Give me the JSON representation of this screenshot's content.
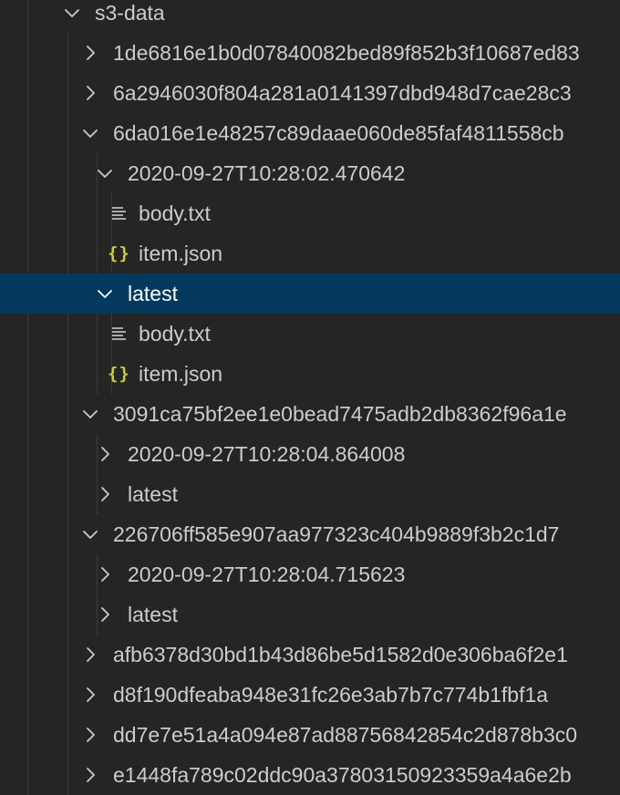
{
  "explorer": {
    "colors": {
      "background": "#252526",
      "selection": "#04395e",
      "text": "#cccccc",
      "selected_text": "#ffffff",
      "json_icon": "#cbcb41",
      "indent_guide": "#3b3b3b"
    },
    "tree": [
      {
        "label": "s3-data",
        "kind": "folder",
        "expanded": true,
        "depth": 0,
        "name": "folder-s3-data"
      },
      {
        "label": "1de6816e1b0d07840082bed89f852b3f10687ed83",
        "kind": "folder",
        "expanded": false,
        "depth": 1,
        "name": "folder-1de6816e"
      },
      {
        "label": "6a2946030f804a281a0141397dbd948d7cae28c3",
        "kind": "folder",
        "expanded": false,
        "depth": 1,
        "name": "folder-6a294603"
      },
      {
        "label": "6da016e1e48257c89daae060de85faf4811558cb",
        "kind": "folder",
        "expanded": true,
        "depth": 1,
        "name": "folder-6da016e1"
      },
      {
        "label": "2020-09-27T10:28:02.470642",
        "kind": "folder",
        "expanded": true,
        "depth": 2,
        "name": "folder-2020-09-27T10-28-02"
      },
      {
        "label": "body.txt",
        "kind": "txt",
        "depth": 3,
        "name": "file-body-txt"
      },
      {
        "label": "item.json",
        "kind": "json",
        "depth": 3,
        "name": "file-item-json"
      },
      {
        "label": "latest",
        "kind": "folder",
        "expanded": true,
        "depth": 2,
        "selected": true,
        "name": "folder-latest"
      },
      {
        "label": "body.txt",
        "kind": "txt",
        "depth": 3,
        "name": "file-body-txt"
      },
      {
        "label": "item.json",
        "kind": "json",
        "depth": 3,
        "name": "file-item-json"
      },
      {
        "label": "3091ca75bf2ee1e0bead7475adb2db8362f96a1e",
        "kind": "folder",
        "expanded": true,
        "depth": 1,
        "name": "folder-3091ca75"
      },
      {
        "label": "2020-09-27T10:28:04.864008",
        "kind": "folder",
        "expanded": false,
        "depth": 2,
        "name": "folder-2020-09-27T10-28-04-864008"
      },
      {
        "label": "latest",
        "kind": "folder",
        "expanded": false,
        "depth": 2,
        "name": "folder-latest"
      },
      {
        "label": "226706ff585e907aa977323c404b9889f3b2c1d7",
        "kind": "folder",
        "expanded": true,
        "depth": 1,
        "name": "folder-226706ff"
      },
      {
        "label": "2020-09-27T10:28:04.715623",
        "kind": "folder",
        "expanded": false,
        "depth": 2,
        "name": "folder-2020-09-27T10-28-04-715623"
      },
      {
        "label": "latest",
        "kind": "folder",
        "expanded": false,
        "depth": 2,
        "name": "folder-latest"
      },
      {
        "label": "afb6378d30bd1b43d86be5d1582d0e306ba6f2e1",
        "kind": "folder",
        "expanded": false,
        "depth": 1,
        "name": "folder-afb6378d"
      },
      {
        "label": "d8f190dfeaba948e31fc26e3ab7b7c774b1fbf1a",
        "kind": "folder",
        "expanded": false,
        "depth": 1,
        "name": "folder-d8f190df"
      },
      {
        "label": "dd7e7e51a4a094e87ad88756842854c2d878b3c0",
        "kind": "folder",
        "expanded": false,
        "depth": 1,
        "name": "folder-dd7e7e51"
      },
      {
        "label": "e1448fa789c02ddc90a37803150923359a4a6e2b",
        "kind": "folder",
        "expanded": false,
        "depth": 1,
        "name": "folder-e1448fa7"
      }
    ]
  }
}
